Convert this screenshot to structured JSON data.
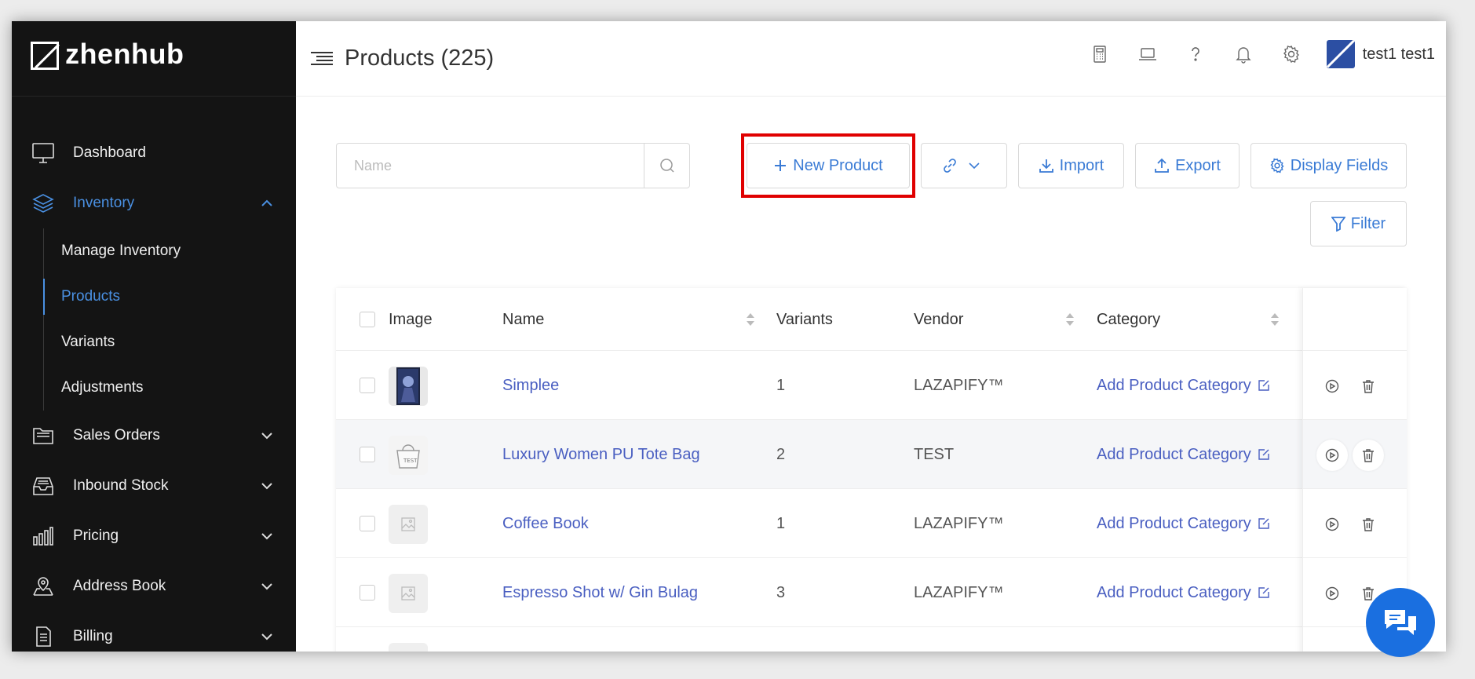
{
  "app": {
    "brand": "zhenhub"
  },
  "header": {
    "title": "Products (225)",
    "user_name": "test1 test1"
  },
  "sidebar": {
    "items": [
      {
        "label": "Dashboard",
        "icon": "monitor-icon"
      },
      {
        "label": "Inventory",
        "icon": "layers-icon",
        "expanded": true
      },
      {
        "label": "Sales Orders",
        "icon": "folder-icon"
      },
      {
        "label": "Inbound Stock",
        "icon": "inbox-icon"
      },
      {
        "label": "Pricing",
        "icon": "bar-chart-icon"
      },
      {
        "label": "Address Book",
        "icon": "map-pin-icon"
      },
      {
        "label": "Billing",
        "icon": "document-icon"
      }
    ],
    "inventory_sub": [
      {
        "label": "Manage Inventory"
      },
      {
        "label": "Products",
        "active": true
      },
      {
        "label": "Variants"
      },
      {
        "label": "Adjustments"
      }
    ]
  },
  "toolbar": {
    "search_placeholder": "Name",
    "new_product": "New Product",
    "import": "Import",
    "export": "Export",
    "display_fields": "Display Fields",
    "filter": "Filter"
  },
  "table": {
    "columns": {
      "image": "Image",
      "name": "Name",
      "variants": "Variants",
      "vendor": "Vendor",
      "category": "Category"
    },
    "rows": [
      {
        "name": "Simplee",
        "variants": "1",
        "vendor": "LAZAPIFY™",
        "category": "Add Product Category"
      },
      {
        "name": "Luxury Women PU Tote Bag",
        "variants": "2",
        "vendor": "TEST",
        "category": "Add Product Category"
      },
      {
        "name": "Coffee Book",
        "variants": "1",
        "vendor": "LAZAPIFY™",
        "category": "Add Product Category"
      },
      {
        "name": "Espresso Shot w/ Gin Bulag",
        "variants": "3",
        "vendor": "LAZAPIFY™",
        "category": "Add Product Category"
      }
    ]
  },
  "colors": {
    "accent": "#4a90e2",
    "link": "#4a5fc1",
    "sidebar_bg": "#141414",
    "highlight": "#e00000",
    "chat": "#1a6fe0"
  }
}
